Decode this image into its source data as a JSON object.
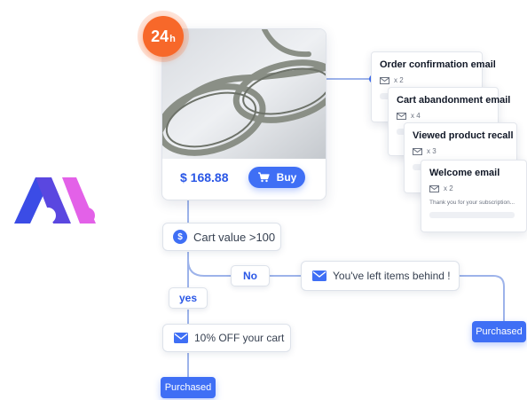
{
  "badge": {
    "number": "24",
    "unit": "h"
  },
  "product": {
    "price": "$ 168.88",
    "buy_label": "Buy"
  },
  "flow": {
    "condition_icon": "$",
    "condition_label": "Cart value >100",
    "no_label": "No",
    "yes_label": "yes",
    "left_items_label": "You've left items behind !",
    "discount_label": "10% OFF your cart",
    "purchased_left": "Purchased",
    "purchased_right": "Purchased"
  },
  "emails": [
    {
      "title": "Order confirmation email",
      "count": "x 2"
    },
    {
      "title": "Cart abandonment email",
      "count": "x 4"
    },
    {
      "title": "Viewed product recall",
      "count": "x 3"
    },
    {
      "title": "Welcome email",
      "count": "x 2",
      "body": "Thank you for your subscription..."
    }
  ],
  "colors": {
    "accent_blue": "#3f6ff5",
    "badge_orange": "#f7682a",
    "logo_blue": "#3b4ce6",
    "logo_pink": "#e361e8",
    "connector": "#9db3ea"
  },
  "icons": [
    "cart-icon",
    "dollar-icon",
    "envelope-icon",
    "logo-mark"
  ]
}
